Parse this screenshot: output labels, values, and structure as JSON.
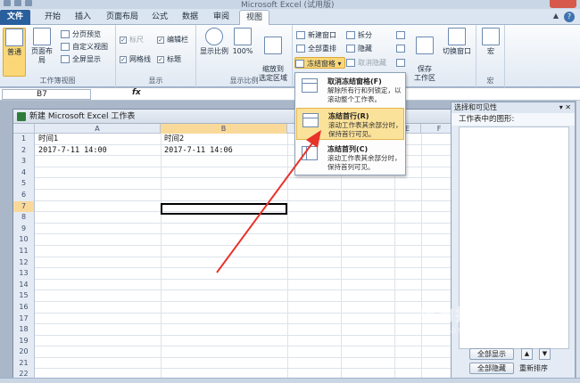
{
  "window": {
    "title": "Microsoft Excel (试用版)"
  },
  "tabs": [
    {
      "label": "文件"
    },
    {
      "label": "开始"
    },
    {
      "label": "插入"
    },
    {
      "label": "页面布局"
    },
    {
      "label": "公式"
    },
    {
      "label": "数据"
    },
    {
      "label": "审阅"
    },
    {
      "label": "视图"
    }
  ],
  "ribbon": {
    "workbook_views": {
      "label": "工作簿视图",
      "normal": "普通",
      "page_layout": "页面布局",
      "page_break": "分页预览",
      "custom_views": "自定义视图",
      "full_screen": "全屏显示"
    },
    "show": {
      "label": "显示",
      "ruler": "标尺",
      "formula_bar": "编辑栏",
      "gridlines": "网格线",
      "headings": "标题"
    },
    "zoom": {
      "label": "显示比例",
      "zoom": "显示比例",
      "hundred": "100%",
      "zoom_to_selection": "缩放到\n选定区域"
    },
    "window": {
      "new_window": "新建窗口",
      "arrange_all": "全部重排",
      "freeze_panes": "冻结窗格",
      "split": "拆分",
      "hide": "隐藏",
      "unhide": "取消隐藏",
      "save_workspace": "保存\n工作区",
      "switch_windows": "切换窗口"
    },
    "macros": {
      "label": "宏",
      "macro": "宏"
    }
  },
  "formula_bar": {
    "name_box": "B7",
    "fx": "fx",
    "value": ""
  },
  "workbook": {
    "title": "新建 Microsoft Excel 工作表",
    "columns": [
      "A",
      "B",
      "C",
      "D",
      "E",
      "F"
    ],
    "selected_column": "B",
    "selected_row": "7",
    "rows": [
      {
        "num": "1",
        "a": "时间1",
        "b": "时间2"
      },
      {
        "num": "2",
        "a": "2017-7-11 14:00",
        "b": "2017-7-11 14:06"
      },
      {
        "num": "3",
        "a": "",
        "b": ""
      },
      {
        "num": "4",
        "a": "",
        "b": ""
      },
      {
        "num": "5",
        "a": "",
        "b": ""
      },
      {
        "num": "6",
        "a": "",
        "b": ""
      },
      {
        "num": "7",
        "a": "",
        "b": ""
      },
      {
        "num": "8",
        "a": "",
        "b": ""
      },
      {
        "num": "9",
        "a": "",
        "b": ""
      },
      {
        "num": "10",
        "a": "",
        "b": ""
      },
      {
        "num": "11",
        "a": "",
        "b": ""
      },
      {
        "num": "12",
        "a": "",
        "b": ""
      },
      {
        "num": "13",
        "a": "",
        "b": ""
      },
      {
        "num": "14",
        "a": "",
        "b": ""
      },
      {
        "num": "15",
        "a": "",
        "b": ""
      },
      {
        "num": "16",
        "a": "",
        "b": ""
      },
      {
        "num": "17",
        "a": "",
        "b": ""
      },
      {
        "num": "18",
        "a": "",
        "b": ""
      },
      {
        "num": "19",
        "a": "",
        "b": ""
      },
      {
        "num": "20",
        "a": "",
        "b": ""
      },
      {
        "num": "21",
        "a": "",
        "b": ""
      },
      {
        "num": "22",
        "a": "",
        "b": ""
      }
    ]
  },
  "freeze_menu": {
    "items": [
      {
        "title": "取消冻结窗格(F)",
        "desc": "解除所有行和列锁定，以滚动整个工作表。"
      },
      {
        "title": "冻结首行(R)",
        "desc": "滚动工作表其余部分时，保持首行可见。"
      },
      {
        "title": "冻结首列(C)",
        "desc": "滚动工作表其余部分时，保持首列可见。"
      }
    ],
    "highlighted_index": 1
  },
  "selection_pane": {
    "title": "选择和可见性",
    "section_label": "工作表中的图形:",
    "show_all": "全部显示",
    "hide_all": "全部隐藏",
    "reorder": "重新排序"
  },
  "watermark": {
    "text": "搜狗指南",
    "sub": "zhinan.sogou.com"
  },
  "colors": {
    "accent": "#2a5f9e",
    "highlight": "#fbe29a",
    "arrow": "#e8332a",
    "excel_green": "#2f7d3b"
  }
}
